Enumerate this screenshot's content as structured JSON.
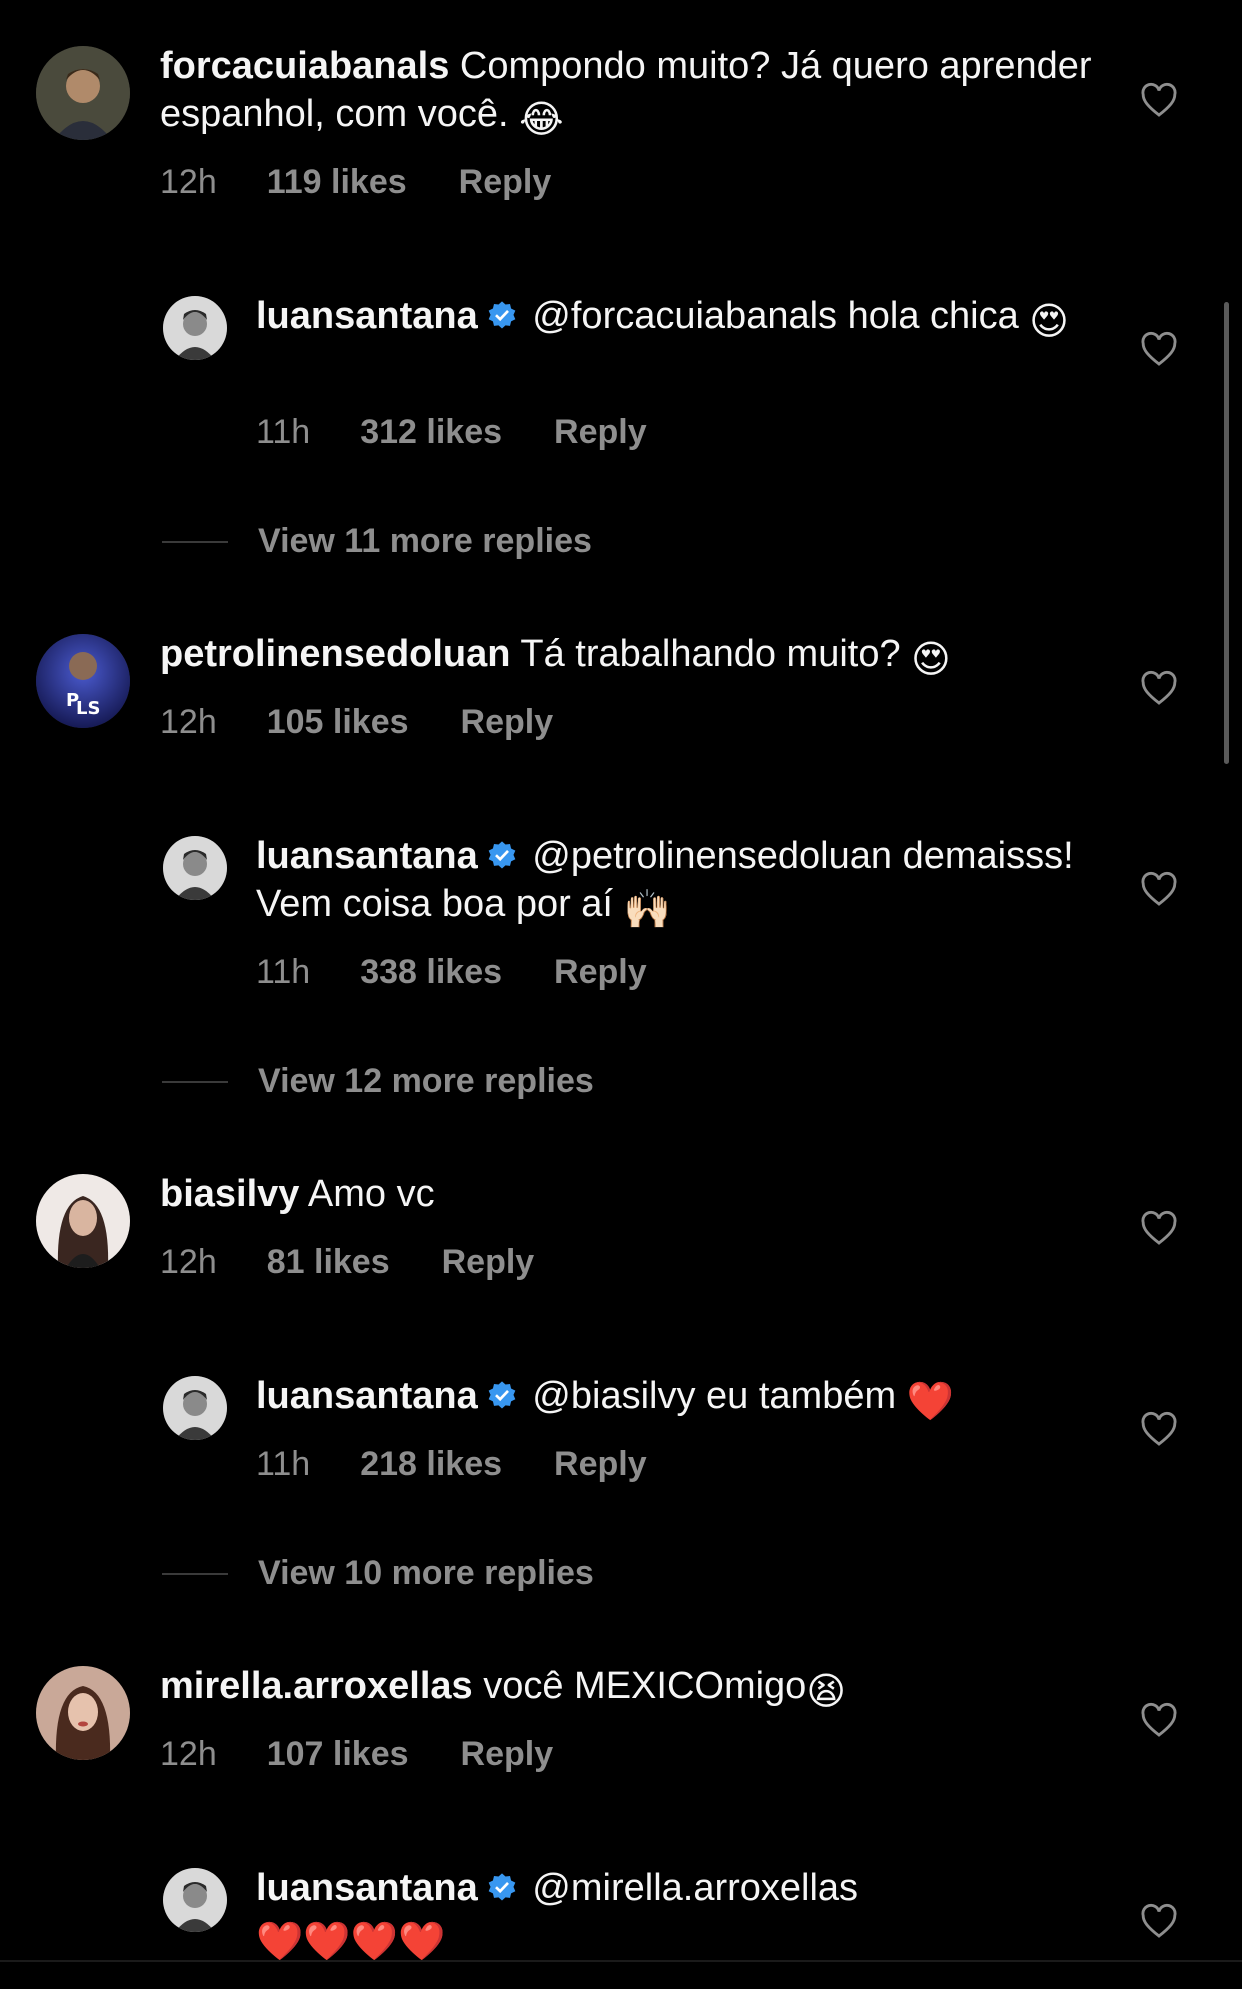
{
  "threads": [
    {
      "comment": {
        "username": "forcacuiabanals",
        "text": "Compondo muito? Já quero aprender espanhol, com você.",
        "emoji": "😂",
        "time": "12h",
        "likes": "119 likes",
        "reply": "Reply"
      },
      "reply": {
        "username": "luansantana",
        "mention": "@forcacuiabanals",
        "text": "hola chica",
        "emoji": "😍",
        "time": "11h",
        "likes": "312 likes",
        "reply": "Reply"
      },
      "view_more": "View 11 more replies"
    },
    {
      "comment": {
        "username": "petrolinensedoluan",
        "text": "Tá trabalhando muito?",
        "emoji": "😍",
        "time": "12h",
        "likes": "105 likes",
        "reply": "Reply"
      },
      "reply": {
        "username": "luansantana",
        "mention": "@petrolinensedoluan",
        "text": "demaisss! Vem coisa boa por aí",
        "emoji": "🙌🏻",
        "time": "11h",
        "likes": "338 likes",
        "reply": "Reply"
      },
      "view_more": "View 12 more replies"
    },
    {
      "comment": {
        "username": "biasilvy",
        "text": "Amo vc",
        "emoji": "",
        "time": "12h",
        "likes": "81 likes",
        "reply": "Reply"
      },
      "reply": {
        "username": "luansantana",
        "mention": "@biasilvy",
        "text": "eu também",
        "emoji": "❤️",
        "time": "11h",
        "likes": "218 likes",
        "reply": "Reply"
      },
      "view_more": "View 10 more replies"
    },
    {
      "comment": {
        "username": "mirella.arroxellas",
        "text": "você MEXICOmigo",
        "emoji": "😫",
        "time": "12h",
        "likes": "107 likes",
        "reply": "Reply"
      },
      "reply": {
        "username": "luansantana",
        "mention": "@mirella.arroxellas",
        "text": "",
        "emoji": "❤️❤️❤️❤️"
      }
    }
  ],
  "colors": {
    "background": "#000000",
    "text": "#f5f5f5",
    "meta": "#8e8e8e",
    "verified": "#3897f0"
  }
}
